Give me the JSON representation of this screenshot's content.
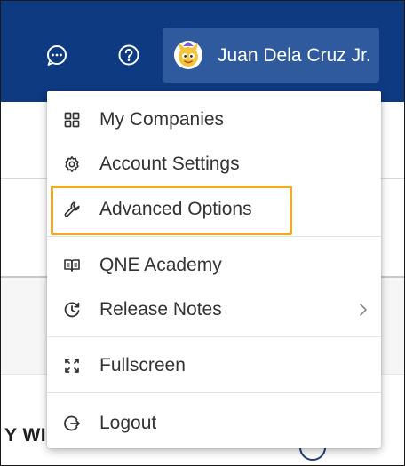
{
  "header": {
    "chat_icon": "chat-bubble-icon",
    "help_icon": "help-icon",
    "user": {
      "name": "Juan Dela Cruz Jr.",
      "avatar_icon": "cartoon-avatar-icon"
    },
    "background_color": "#0e3a82",
    "chip_color": "#2f5b9e"
  },
  "menu": {
    "items": [
      {
        "label": "My Companies",
        "icon": "grid-icon"
      },
      {
        "label": "Account Settings",
        "icon": "gear-icon"
      },
      {
        "label": "Advanced Options",
        "icon": "wrench-icon",
        "highlighted": true
      },
      {
        "label": "QNE Academy",
        "icon": "book-icon"
      },
      {
        "label": "Release Notes",
        "icon": "history-icon",
        "has_submenu": true
      },
      {
        "label": "Fullscreen",
        "icon": "fullscreen-icon"
      },
      {
        "label": "Logout",
        "icon": "logout-icon"
      }
    ],
    "highlight_color": "#f0a92b"
  },
  "page": {
    "partial_heading": "Y WI"
  }
}
